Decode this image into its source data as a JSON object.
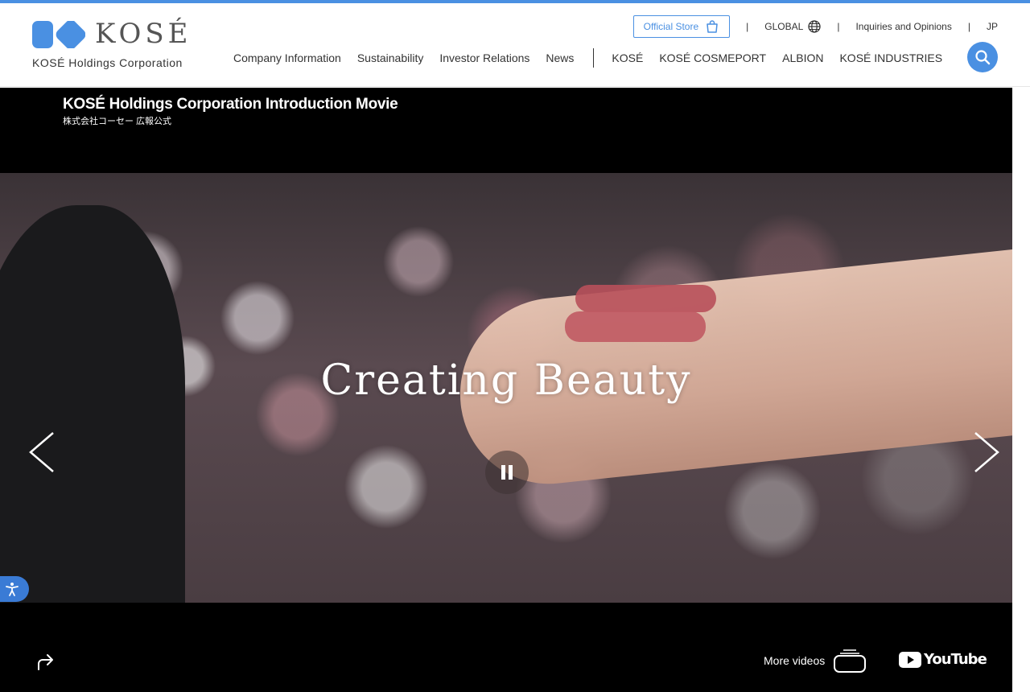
{
  "header": {
    "logo_text": "KOSÉ",
    "logo_subtitle": "KOSÉ Holdings Corporation",
    "utility": {
      "store_label": "Official Store",
      "global_label": "GLOBAL",
      "inquiries_label": "Inquiries and Opinions",
      "lang_label": "JP",
      "separator": "|"
    },
    "nav": {
      "company": "Company Information",
      "sustainability": "Sustainability",
      "investor": "Investor Relations",
      "news": "News",
      "kose": "KOSÉ",
      "cosmeport": "KOSÉ COSMEPORT",
      "albion": "ALBION",
      "industries": "KOSÉ INDUSTRIES"
    }
  },
  "video": {
    "title": "KOSÉ Holdings Corporation Introduction Movie",
    "channel": "株式会社コーセー 広報公式",
    "tagline": "Creating Beauty",
    "more_videos_label": "More videos",
    "youtube_label": "YouTube"
  },
  "colors": {
    "accent": "#4a90e2",
    "video_bg": "#000000",
    "a11y": "#3a7bd5"
  },
  "icons": {
    "logo": "kose-logo-mark",
    "store": "shopping-bag-icon",
    "global": "globe-icon",
    "search": "search-icon",
    "prev": "chevron-left-icon",
    "next": "chevron-right-icon",
    "pause": "pause-icon",
    "share": "share-icon",
    "more_videos": "video-stack-icon",
    "youtube": "youtube-logo",
    "accessibility": "accessibility-icon"
  }
}
